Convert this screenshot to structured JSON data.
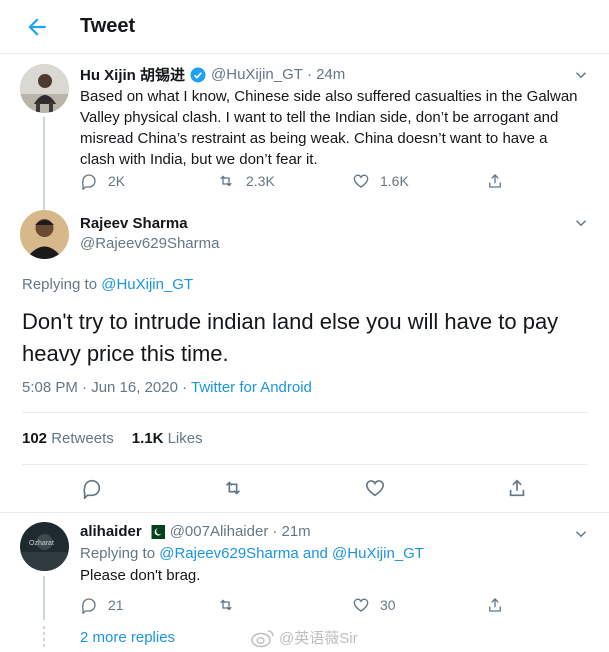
{
  "header": {
    "title": "Tweet"
  },
  "parent_tweet": {
    "name": "Hu Xijin 胡锡进",
    "handle": "@HuXijin_GT",
    "time": "· 24m",
    "text": "Based on what I know, Chinese side also suffered casualties in the Galwan Valley physical clash. I want to tell the Indian side, don’t be arrogant and misread China’s restraint as being weak. China doesn’t want to have a clash with India, but we don’t fear it.",
    "replies": "2K",
    "retweets": "2.3K",
    "likes": "1.6K"
  },
  "main_tweet": {
    "name": "Rajeev Sharma",
    "handle": "@Rajeev629Sharma",
    "replying_prefix": "Replying to",
    "replying_to": "@HuXijin_GT",
    "text": "Don't try to intrude indian land else you will have to pay heavy price this time.",
    "timestamp": "5:08 PM · Jun 16, 2020 · ",
    "source": "Twitter for Android",
    "retweets_count": "102",
    "retweets_label": "Retweets",
    "likes_count": "1.1K",
    "likes_label": "Likes"
  },
  "reply": {
    "name": "alihaider",
    "handle": "@007Alihaider",
    "time": "· 21m",
    "replying_prefix": "Replying to",
    "replying_to": "@Rajeev629Sharma and @HuXijin_GT",
    "text": "Please don't brag.",
    "replies": "21",
    "likes": "30",
    "avatar_text": "Ozharat"
  },
  "more_replies": "2 more replies",
  "watermark": "@英语薇Sir",
  "colors": {
    "accent": "#1da1f2",
    "link": "#1b95e0",
    "muted": "#657786",
    "divider": "#e6ecf0",
    "verified": "#1da1f2"
  }
}
